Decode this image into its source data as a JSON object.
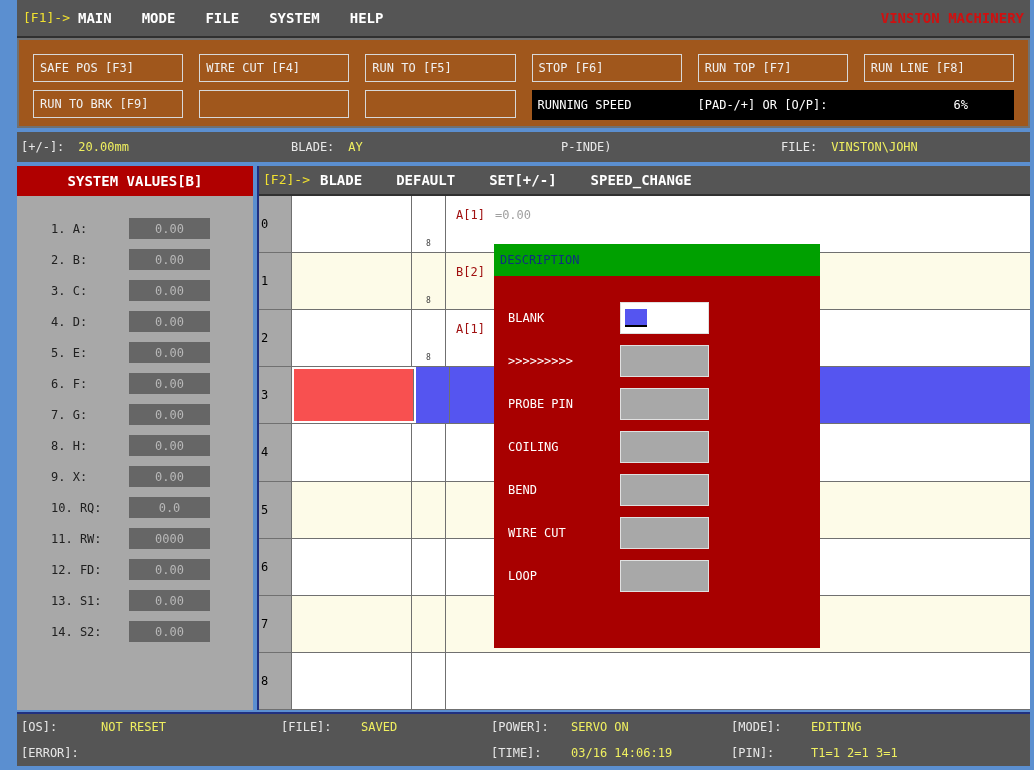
{
  "menu": {
    "prefix": "[F1]->",
    "items": [
      "MAIN",
      "MODE",
      "FILE",
      "SYSTEM",
      "HELP"
    ],
    "brand": "VINSTON MACHINERY"
  },
  "toolbar": {
    "buttons": [
      {
        "label": "SAFE POS [F3]"
      },
      {
        "label": "WIRE CUT [F4]"
      },
      {
        "label": "RUN TO [F5]"
      },
      {
        "label": "STOP [F6]"
      },
      {
        "label": "RUN TOP [F7]"
      },
      {
        "label": "RUN LINE [F8]"
      },
      {
        "label": "RUN TO BRK [F9]"
      },
      {
        "kind": "blank"
      },
      {
        "kind": "blank"
      }
    ],
    "speed": {
      "label": "RUNNING SPEED",
      "hint": "[PAD-/+] OR [O/P]:",
      "value": "6%"
    }
  },
  "info_bar": [
    {
      "label": "[+/-]:",
      "value": "20.00mm"
    },
    {
      "label": "BLADE:",
      "value": "AY"
    },
    {
      "label": "P-INDE)"
    },
    {
      "label": "FILE:",
      "value": "VINSTON\\JOHN"
    }
  ],
  "system_values": {
    "title": "SYSTEM VALUES[B]",
    "items": [
      {
        "label": "1. A:",
        "value": "0.00"
      },
      {
        "label": "2. B:",
        "value": "0.00"
      },
      {
        "label": "3. C:",
        "value": "0.00"
      },
      {
        "label": "4. D:",
        "value": "0.00"
      },
      {
        "label": "5. E:",
        "value": "0.00"
      },
      {
        "label": "6. F:",
        "value": "0.00"
      },
      {
        "label": "7. G:",
        "value": "0.00"
      },
      {
        "label": "8. H:",
        "value": "0.00"
      },
      {
        "label": "9. X:",
        "value": "0.00"
      },
      {
        "label": "10. RQ:",
        "value": "0.0"
      },
      {
        "label": "11. RW:",
        "value": "0000"
      },
      {
        "label": "12. FD:",
        "value": "0.00"
      },
      {
        "label": "13. S1:",
        "value": "0.00"
      },
      {
        "label": "14. S2:",
        "value": "0.00"
      }
    ]
  },
  "grid": {
    "prefix": "[F2]->",
    "items": [
      "BLADE",
      "DEFAULT",
      "SET[+/-]",
      "SPEED_CHANGE"
    ],
    "rows": [
      {
        "number": "0",
        "mark": "8",
        "code": "A[1]",
        "value": "=0.00",
        "selected": false
      },
      {
        "number": "1",
        "mark": "8",
        "code": "B[2]",
        "selected": false
      },
      {
        "number": "2",
        "mark": "8",
        "code": "A[1]",
        "selected": false
      },
      {
        "number": "3",
        "selected": true
      },
      {
        "number": "4",
        "selected": false
      },
      {
        "number": "5",
        "selected": false
      },
      {
        "number": "6",
        "selected": false
      },
      {
        "number": "7",
        "selected": false
      },
      {
        "number": "8",
        "selected": false
      }
    ]
  },
  "dialog": {
    "title": "DESCRIPTION",
    "fields": [
      {
        "label": "BLANK",
        "focused": true
      },
      {
        "label": ">>>>>>>>>",
        "focused": false
      },
      {
        "label": "PROBE PIN",
        "focused": false
      },
      {
        "label": "COILING",
        "focused": false
      },
      {
        "label": "BEND",
        "focused": false
      },
      {
        "label": "WIRE CUT",
        "focused": false
      },
      {
        "label": "LOOP",
        "focused": false
      }
    ]
  },
  "status_bar": [
    {
      "label": "[OS]:",
      "value": "NOT RESET"
    },
    {
      "label": "[FILE]:",
      "value": "SAVED"
    },
    {
      "label": "[POWER]:",
      "value": "SERVO ON"
    },
    {
      "label": "[MODE]:",
      "value": "EDITING"
    },
    {
      "label": "[ERROR]:"
    },
    {
      "label": "[TIME]:",
      "value": "03/16 14:06:19"
    },
    {
      "label": "[PIN]:",
      "value": "T1=1 2=1 3=1"
    }
  ]
}
